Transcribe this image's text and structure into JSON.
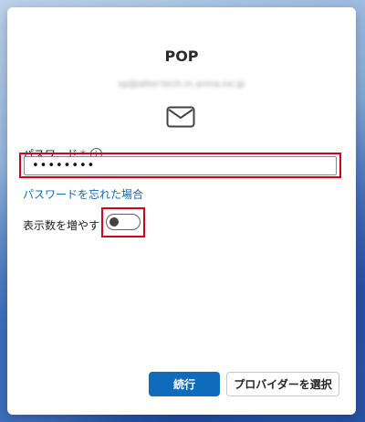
{
  "dialog": {
    "title": "POP",
    "email": "sp@alter-tech.in.arma.ne.jp",
    "icon": "mail-icon"
  },
  "password": {
    "label": "パスワード",
    "required_mark": "*",
    "info_icon": "info-icon",
    "value": "••••••••",
    "forgot_link": "パスワードを忘れた場合"
  },
  "more_options": {
    "label": "表示数を増やす",
    "toggle_on": false
  },
  "buttons": {
    "continue": "続行",
    "choose_provider": "プロバイダーを選択"
  },
  "colors": {
    "accent": "#0f6cbd",
    "highlight": "#d0021b"
  }
}
